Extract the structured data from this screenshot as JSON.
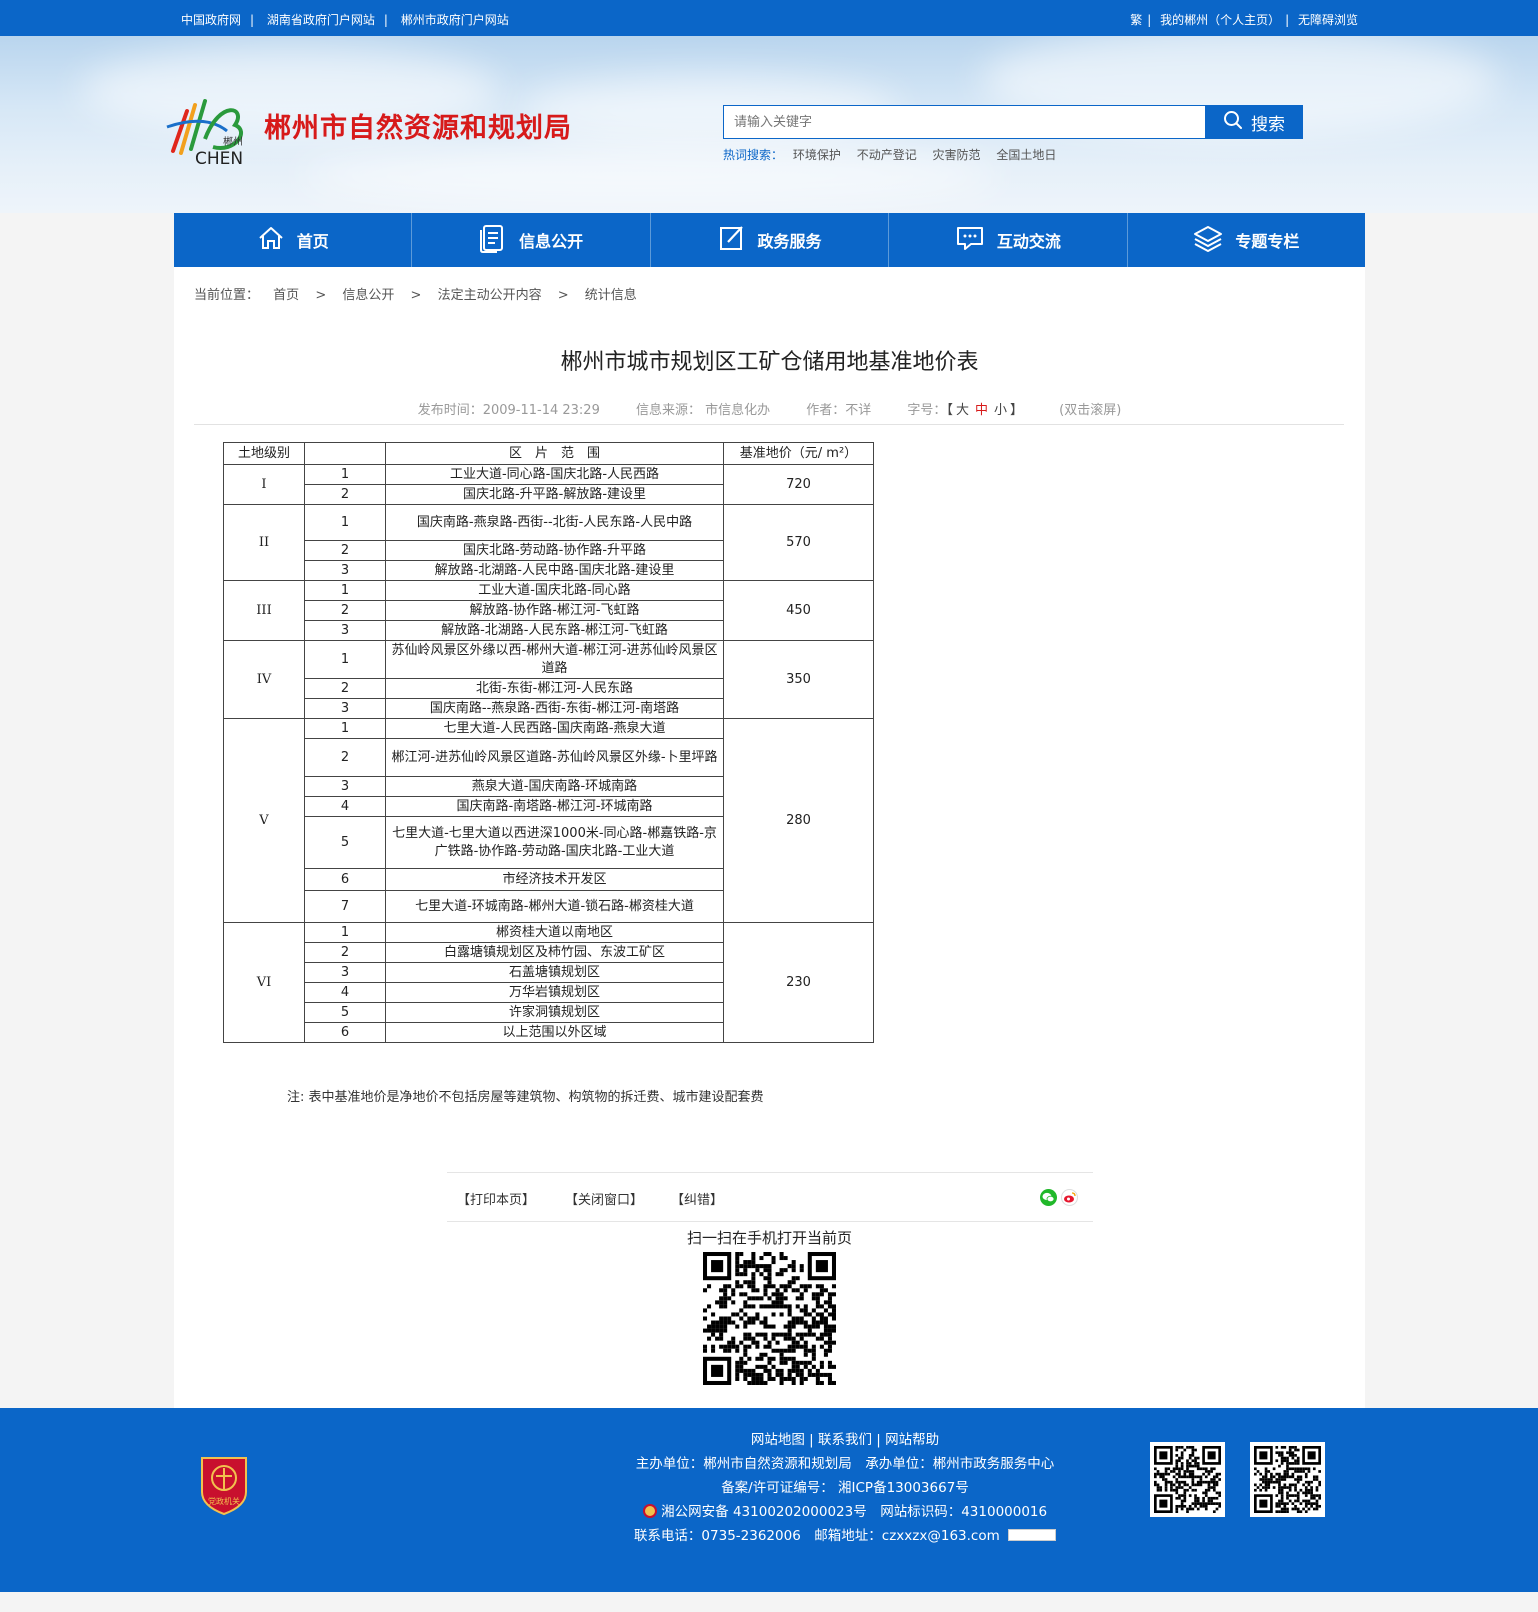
{
  "topbar": {
    "links_left": [
      "中国政府网",
      "湖南省政府门户网站",
      "郴州市政府门户网站"
    ],
    "traditional": "繁",
    "my_chenzhou": "我的郴州（个人主页）",
    "accessible": "无障碍浏览"
  },
  "header": {
    "logo_small": "郴州",
    "logo_text": "CHEN",
    "site_title": "郴州市自然资源和规划局",
    "search_placeholder": "请输入关键字",
    "search_button": "搜索",
    "hot_label": "热词搜索：",
    "hot_words": [
      "环境保护",
      "不动产登记",
      "灾害防范",
      "全国土地日"
    ]
  },
  "nav": [
    "首页",
    "信息公开",
    "政务服务",
    "互动交流",
    "专题专栏"
  ],
  "breadcrumb": {
    "label": "当前位置：",
    "items": [
      "首页",
      "信息公开",
      "法定主动公开内容",
      "统计信息"
    ],
    "arrow": ">"
  },
  "article": {
    "title": "郴州市城市规划区工矿仓储用地基准地价表",
    "publish_time": "发布时间：2009-11-14 23:29",
    "source": "信息来源： 市信息化办",
    "author": "作者：不详",
    "font_size_label": "字号：",
    "font_open": "【",
    "font_close": "】",
    "font_large": "大",
    "font_medium": "中",
    "font_small": "小",
    "scroll_hint": "(双击滚屏)"
  },
  "table": {
    "headers": [
      "土地级别",
      "",
      "区　片　范　围",
      "基准地价（元/ m²）"
    ],
    "groups": [
      {
        "level": "I",
        "price": "720",
        "rows": [
          {
            "no": "1",
            "area": "工业大道-同心路-国庆北路-人民西路"
          },
          {
            "no": "2",
            "area": "国庆北路-升平路-解放路-建设里"
          }
        ]
      },
      {
        "level": "II",
        "price": "570",
        "rows": [
          {
            "no": "1",
            "area": "国庆南路-燕泉路-西街--北街-人民东路-人民中路"
          },
          {
            "no": "2",
            "area": "国庆北路-劳动路-协作路-升平路"
          },
          {
            "no": "3",
            "area": "解放路-北湖路-人民中路-国庆北路-建设里"
          }
        ]
      },
      {
        "level": "III",
        "price": "450",
        "rows": [
          {
            "no": "1",
            "area": "工业大道-国庆北路-同心路"
          },
          {
            "no": "2",
            "area": "解放路-协作路-郴江河-飞虹路"
          },
          {
            "no": "3",
            "area": "解放路-北湖路-人民东路-郴江河-飞虹路"
          }
        ]
      },
      {
        "level": "IV",
        "price": "350",
        "rows": [
          {
            "no": "1",
            "area": "苏仙岭风景区外缘以西-郴州大道-郴江河-进苏仙岭风景区道路"
          },
          {
            "no": "2",
            "area": "北街-东街-郴江河-人民东路"
          },
          {
            "no": "3",
            "area": "国庆南路--燕泉路-西街-东街-郴江河-南塔路"
          }
        ]
      },
      {
        "level": "V",
        "price": "280",
        "rows": [
          {
            "no": "1",
            "area": "七里大道-人民西路-国庆南路-燕泉大道"
          },
          {
            "no": "2",
            "area": "郴江河-进苏仙岭风景区道路-苏仙岭风景区外缘-卜里坪路"
          },
          {
            "no": "3",
            "area": "燕泉大道-国庆南路-环城南路"
          },
          {
            "no": "4",
            "area": "国庆南路-南塔路-郴江河-环城南路"
          },
          {
            "no": "5",
            "area": "七里大道-七里大道以西进深1000米-同心路-郴嘉铁路-京广铁路-协作路-劳动路-国庆北路-工业大道"
          },
          {
            "no": "6",
            "area": "市经济技术开发区"
          },
          {
            "no": "7",
            "area": "七里大道-环城南路-郴州大道-锁石路-郴资桂大道"
          }
        ]
      },
      {
        "level": "VI",
        "price": "230",
        "rows": [
          {
            "no": "1",
            "area": "郴资桂大道以南地区"
          },
          {
            "no": "2",
            "area": "白露塘镇规划区及柿竹园、东波工矿区"
          },
          {
            "no": "3",
            "area": "石盖塘镇规划区"
          },
          {
            "no": "4",
            "area": "万华岩镇规划区"
          },
          {
            "no": "5",
            "area": "许家洞镇规划区"
          },
          {
            "no": "6",
            "area": "以上范围以外区域"
          }
        ]
      }
    ],
    "note": "注: 表中基准地价是净地价不包括房屋等建筑物、构筑物的拆迁费、城市建设配套费"
  },
  "tools": {
    "print": "【打印本页】",
    "close": "【关闭窗口】",
    "correct": "【纠错】",
    "scan_text": "扫一扫在手机打开当前页"
  },
  "footer": {
    "links": [
      "网站地图",
      "联系我们",
      "网站帮助"
    ],
    "sponsor": "主办单位：郴州市自然资源和规划局　承办单位：郴州市政务服务中心",
    "icp": "备案/许可证编号： 湘ICP备13003667号",
    "police": "湘公网安备 43100202000023号　网站标识码：4310000016",
    "contact": "联系电话：0735-2362006　邮箱地址：czxxzx@163.com",
    "emblem_text": "党政机关"
  },
  "colors": {
    "primary": "#0b66c8",
    "title_red": "#d71a1a"
  }
}
